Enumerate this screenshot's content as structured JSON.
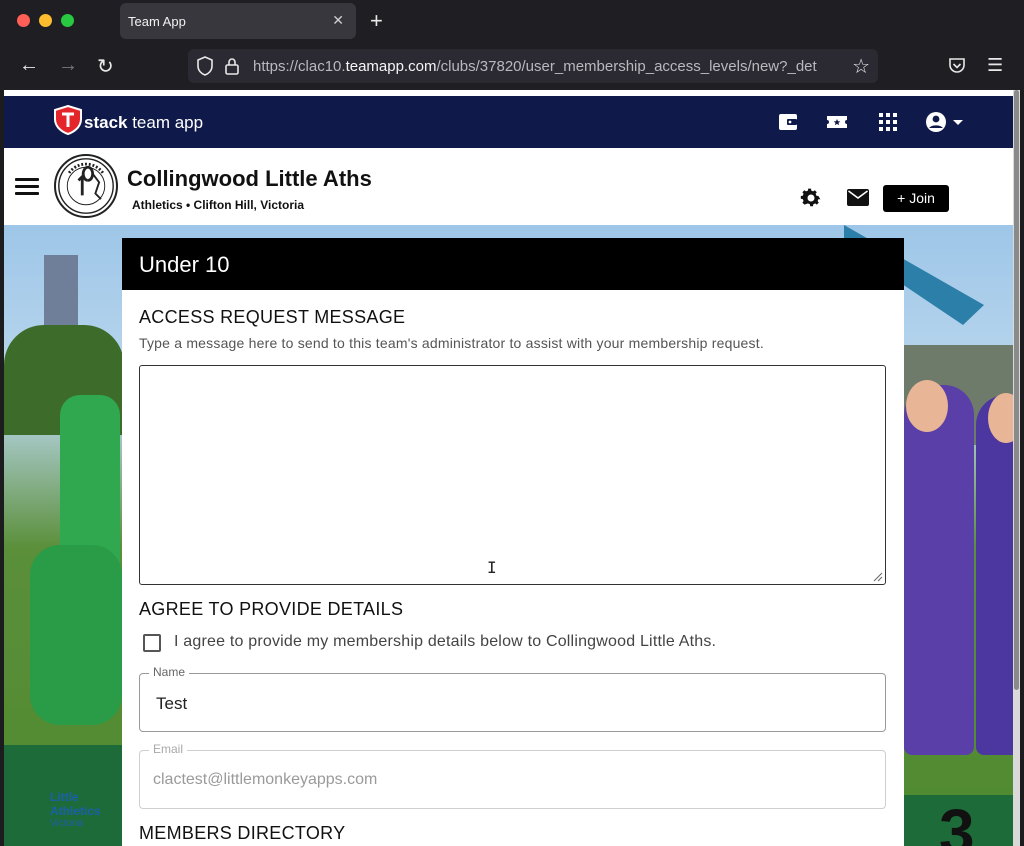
{
  "browser": {
    "tab_title": "Team App",
    "tab_close": "✕",
    "new_tab": "+",
    "back": "←",
    "forward": "→",
    "reload": "↻",
    "url_prefix": "https://clac10.",
    "url_host": "teamapp.com",
    "url_path": "/clubs/37820/user_membership_access_levels/new?_det",
    "bookmark_star": "☆",
    "menu": "☰"
  },
  "appbar": {
    "brand_bold": "stack",
    "brand_rest": " team app"
  },
  "club": {
    "name": "Collingwood Little Aths",
    "subtitle": "Athletics • Clifton Hill, Victoria",
    "join_label": "+ Join"
  },
  "background": {
    "logo_text_1": "Little",
    "logo_text_2": "Athletics",
    "logo_text_3": "Victoria",
    "podium_number": "3"
  },
  "card": {
    "title": "Under 10",
    "access_section_title": "ACCESS REQUEST MESSAGE",
    "access_help": "Type a message here to send to this team's administrator to assist with your membership request.",
    "message_value": "",
    "text_cursor": "I",
    "agree_section_title": "AGREE TO PROVIDE DETAILS",
    "agree_label": "I agree to provide my membership details below to Collingwood Little Aths.",
    "agree_checked": false,
    "name_label": "Name",
    "name_value": "Test",
    "email_label": "Email",
    "email_value": "clactest@littlemonkeyapps.com",
    "directory_section_title": "MEMBERS DIRECTORY"
  },
  "colors": {
    "appbar_bg": "#0f1a4a",
    "card_header_bg": "#000000",
    "join_bg": "#000000",
    "brand_red": "#e4262b"
  }
}
